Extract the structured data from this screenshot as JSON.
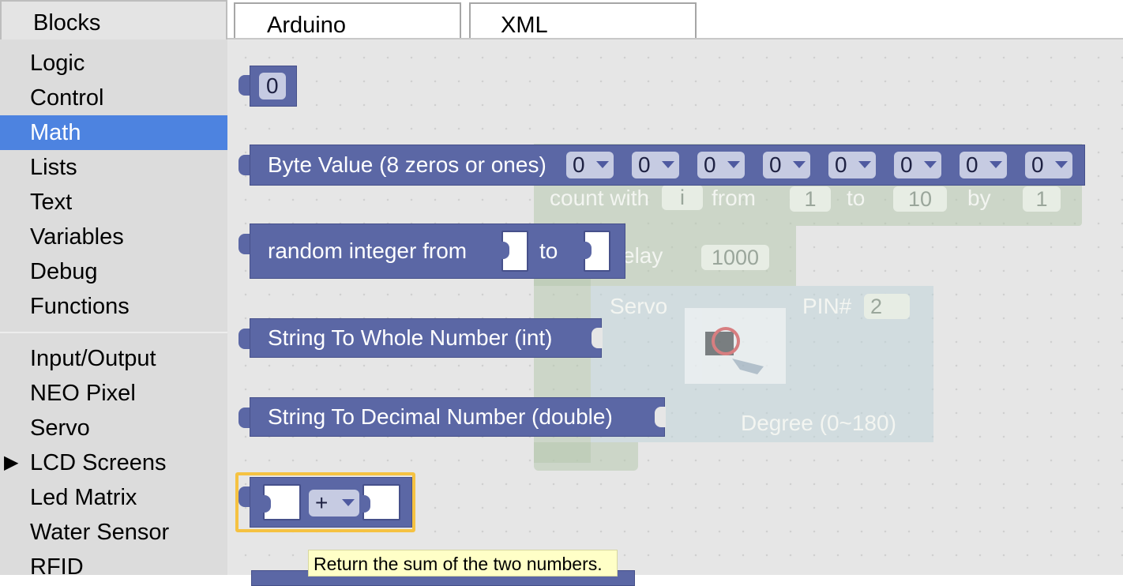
{
  "tabs": [
    {
      "label": "Blocks"
    },
    {
      "label": "Arduino"
    },
    {
      "label": "XML"
    }
  ],
  "toolbox": {
    "selected": "Math",
    "categories": [
      {
        "label": "Logic"
      },
      {
        "label": "Control"
      },
      {
        "label": "Math"
      },
      {
        "label": "Lists"
      },
      {
        "label": "Text"
      },
      {
        "label": "Variables"
      },
      {
        "label": "Debug"
      },
      {
        "label": "Functions"
      },
      {
        "label": "Input/Output"
      },
      {
        "label": "NEO Pixel"
      },
      {
        "label": "Servo"
      },
      {
        "label": "LCD Screens",
        "arrow": "▶"
      },
      {
        "label": "Led Matrix"
      },
      {
        "label": "Water Sensor"
      },
      {
        "label": "RFID"
      }
    ]
  },
  "background_program": {
    "count_with": "count with",
    "var": "i",
    "from": "from",
    "from_val": "1",
    "to": "to",
    "to_val": "10",
    "by": "by",
    "by_val": "1",
    "delay": "elay",
    "delay_val": "1000",
    "servo": "Servo",
    "pin": "PIN#",
    "pin_val": "2",
    "degree": "Degree (0~180)"
  },
  "flyout": {
    "number": {
      "value": "0"
    },
    "byte": {
      "label": "Byte Value (8 zeros or ones)",
      "bits": [
        "0",
        "0",
        "0",
        "0",
        "0",
        "0",
        "0",
        "0"
      ]
    },
    "random": {
      "label": "random integer from",
      "to": "to"
    },
    "str_int": {
      "label": "String To Whole Number (int)"
    },
    "str_double": {
      "label": "String To Decimal Number (double)"
    },
    "arith": {
      "op": "+"
    }
  },
  "tooltip": "Return the sum of the two numbers.",
  "colors": {
    "math_block": "#5b67a5",
    "selected_category": "#4d83e0",
    "highlight": "#f5c242"
  }
}
